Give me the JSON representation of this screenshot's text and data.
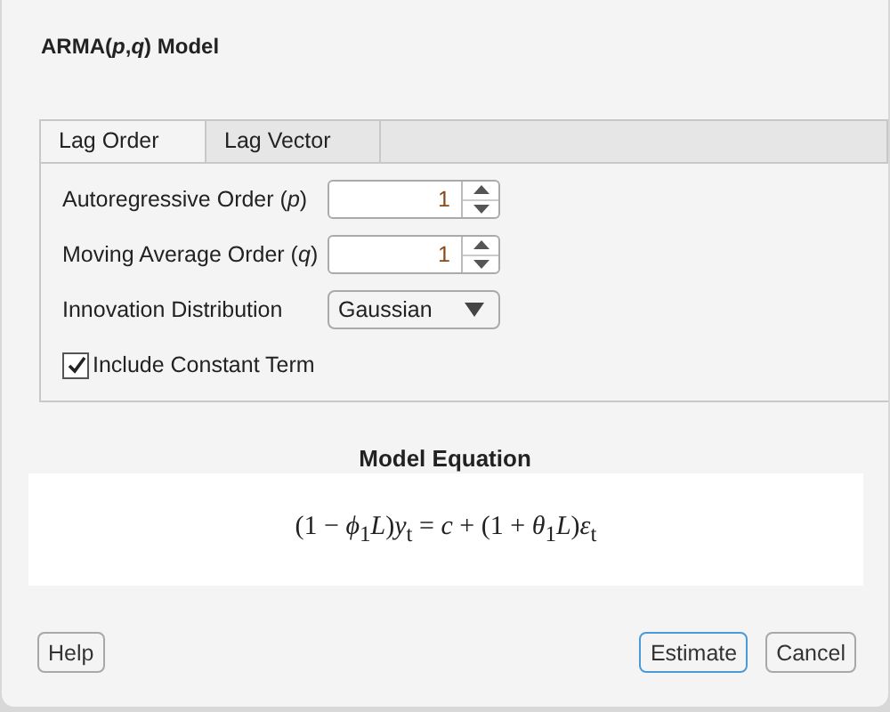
{
  "dialog": {
    "title": "ARMA(*p*,*q*) Model"
  },
  "tabs": [
    {
      "label": "Lag Order",
      "selected": true
    },
    {
      "label": "Lag Vector",
      "selected": false
    }
  ],
  "fields": [
    {
      "kind": "spinner",
      "label": "Autoregressive Order (*p*)",
      "value": "1"
    },
    {
      "kind": "spinner",
      "label": "Moving Average Order (*q*)",
      "value": "1"
    },
    {
      "kind": "dropdown",
      "label": "Innovation Distribution",
      "value": "Gaussian"
    },
    {
      "kind": "checkbox",
      "label": "Include Constant Term",
      "checked": true
    }
  ],
  "equation": {
    "heading": "Model Equation",
    "formula": "(1 − *ϕ*$_{1}$*L*)*y*$_{t}$ = *c* + (1 + *θ*$_{1}$*L*)*ε*$_{t}$"
  },
  "buttons": [
    {
      "label": "Help",
      "kind": "plain"
    },
    {
      "label": "Estimate",
      "kind": "default"
    },
    {
      "label": "Cancel",
      "kind": "plain"
    }
  ]
}
